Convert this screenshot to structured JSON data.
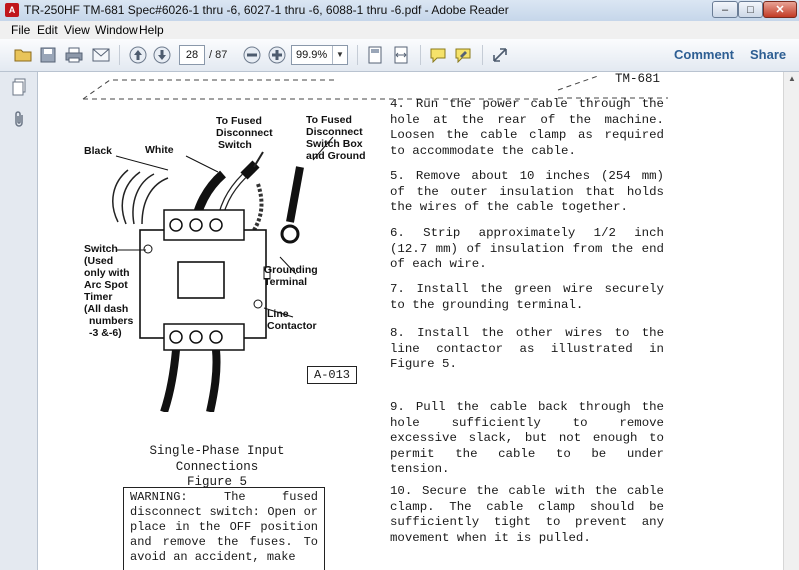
{
  "window": {
    "title": "TR-250HF TM-681 Spec#6026-1 thru -6, 6027-1 thru -6, 6088-1 thru -6.pdf - Adobe Reader",
    "min_symbol": "–",
    "max_symbol": "□",
    "close_symbol": "✕"
  },
  "menu": {
    "file": "File",
    "edit": "Edit",
    "view": "View",
    "window": "Window",
    "help": "Help"
  },
  "toolbar": {
    "current_page": "28",
    "total_pages": "/ 87",
    "zoom": "99.9%",
    "comment_label": "Comment",
    "share_label": "Share"
  },
  "document": {
    "header": "TM-681",
    "steps": [
      "4. Run the power cable through the hole at the rear of the machine. Loosen the cable clamp as required to accommodate the cable.",
      "5. Remove about 10 inches (254 mm) of the outer insulation that holds the wires of the cable together.",
      "6. Strip approximately 1/2 inch (12.7 mm) of insulation from the end of each wire.",
      "7. Install the green wire securely to the grounding terminal.",
      "8. Install the other wires to the line contactor as illustrated in Figure 5.",
      "9. Pull the cable back through the hole sufficiently to remove excessive slack, but not enough to permit the cable to be under tension.",
      "10. Secure the cable with the cable clamp. The cable clamp should be sufficiently tight to prevent any movement when it is pulled."
    ],
    "figure": {
      "caption_line1": "Single-Phase Input Connections",
      "caption_line2": "Figure 5",
      "ref": "A-013",
      "labels": {
        "to_fused_switch_l1": "To Fused",
        "to_fused_switch_l2": "Disconnect",
        "to_fused_switch_l3": "Switch",
        "to_fused_box_l1": "To Fused",
        "to_fused_box_l2": "Disconnect",
        "to_fused_box_l3": "Switch Box",
        "to_fused_box_l4": "and Ground",
        "black": "Black",
        "white": "White",
        "switch_l1": "Switch",
        "switch_l2": "(Used",
        "switch_l3": "only with",
        "switch_l4": "Arc Spot",
        "switch_l5": "Timer",
        "switch_l6": "(All dash",
        "switch_l7": "numbers",
        "switch_l8": "-3 &-6)",
        "grounding_l1": "Grounding",
        "grounding_l2": "Terminal",
        "line_l1": "Line",
        "line_l2": "Contactor"
      }
    },
    "warning": "WARNING: The fused disconnect switch: Open or place in the OFF position and remove the fuses. To avoid an accident, make"
  }
}
